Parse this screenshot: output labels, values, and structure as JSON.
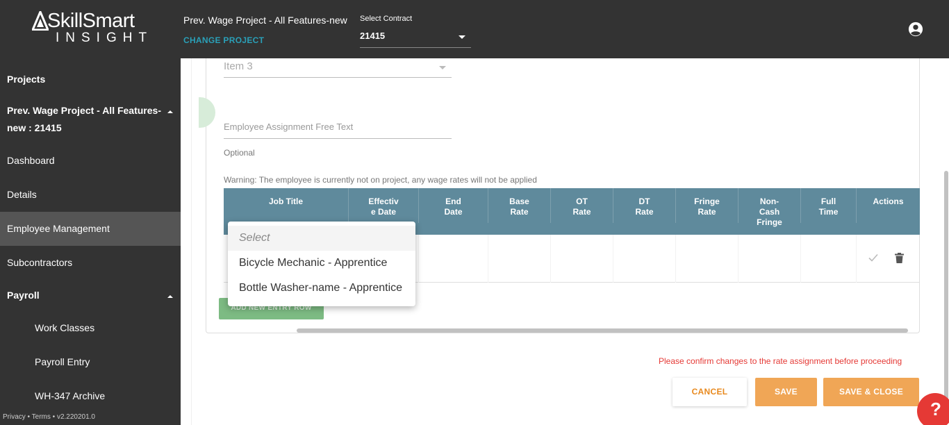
{
  "header": {
    "logo_top": "SkillSmart",
    "logo_bottom": "INSIGHT",
    "project_name": "Prev. Wage Project - All Features-new",
    "change_project": "CHANGE PROJECT",
    "contract_label": "Select Contract",
    "contract_value": "21415",
    "user_icon": "account-circle-icon"
  },
  "sidebar": {
    "items": [
      {
        "label": "Projects"
      },
      {
        "label": "Prev. Wage Project - All Features-",
        "label2": "new : 21415"
      },
      {
        "label": "Dashboard"
      },
      {
        "label": "Details"
      },
      {
        "label": "Employee Management"
      },
      {
        "label": "Subcontractors"
      },
      {
        "label": "Payroll"
      },
      {
        "label": "Work Classes"
      },
      {
        "label": "Payroll Entry"
      },
      {
        "label": "WH-347 Archive"
      }
    ],
    "footer": "Privacy • Terms • v2.220201.0"
  },
  "form": {
    "item3_value": "Item 3",
    "free_text_placeholder": "Employee Assignment Free Text",
    "optional_label": "Optional",
    "warning": "Warning: The employee is currently not on project, any wage rates will not be applied"
  },
  "table": {
    "columns": [
      {
        "l1": "Job Title",
        "l2": "",
        "l3": ""
      },
      {
        "l1": "Effectiv",
        "l2": "e Date",
        "l3": ""
      },
      {
        "l1": "End",
        "l2": "Date",
        "l3": ""
      },
      {
        "l1": "Base",
        "l2": "Rate",
        "l3": ""
      },
      {
        "l1": "OT",
        "l2": "Rate",
        "l3": ""
      },
      {
        "l1": "DT",
        "l2": "Rate",
        "l3": ""
      },
      {
        "l1": "Fringe",
        "l2": "Rate",
        "l3": ""
      },
      {
        "l1": "Non-",
        "l2": "Cash",
        "l3": "Fringe"
      },
      {
        "l1": "Full",
        "l2": "Time",
        "l3": ""
      },
      {
        "l1": "Actions",
        "l2": "",
        "l3": ""
      }
    ],
    "add_row_label": "ADD NEW ENTRY ROW"
  },
  "dropdown": {
    "placeholder": "Select",
    "options": [
      "Bicycle Mechanic - Apprentice",
      "Bottle Washer-name - Apprentice"
    ]
  },
  "footer": {
    "confirm_message": "Please confirm changes to the rate assignment before proceeding",
    "cancel_label": "CANCEL",
    "save_label": "SAVE",
    "save_close_label": "SAVE & CLOSE",
    "help_label": "?"
  },
  "colors": {
    "header_bg": "#333333",
    "accent_teal": "#2aa0b8",
    "table_header": "#5f8a9c",
    "save_orange": "#f0a656",
    "warning_red": "#e53935",
    "add_green": "#7dbb83"
  }
}
